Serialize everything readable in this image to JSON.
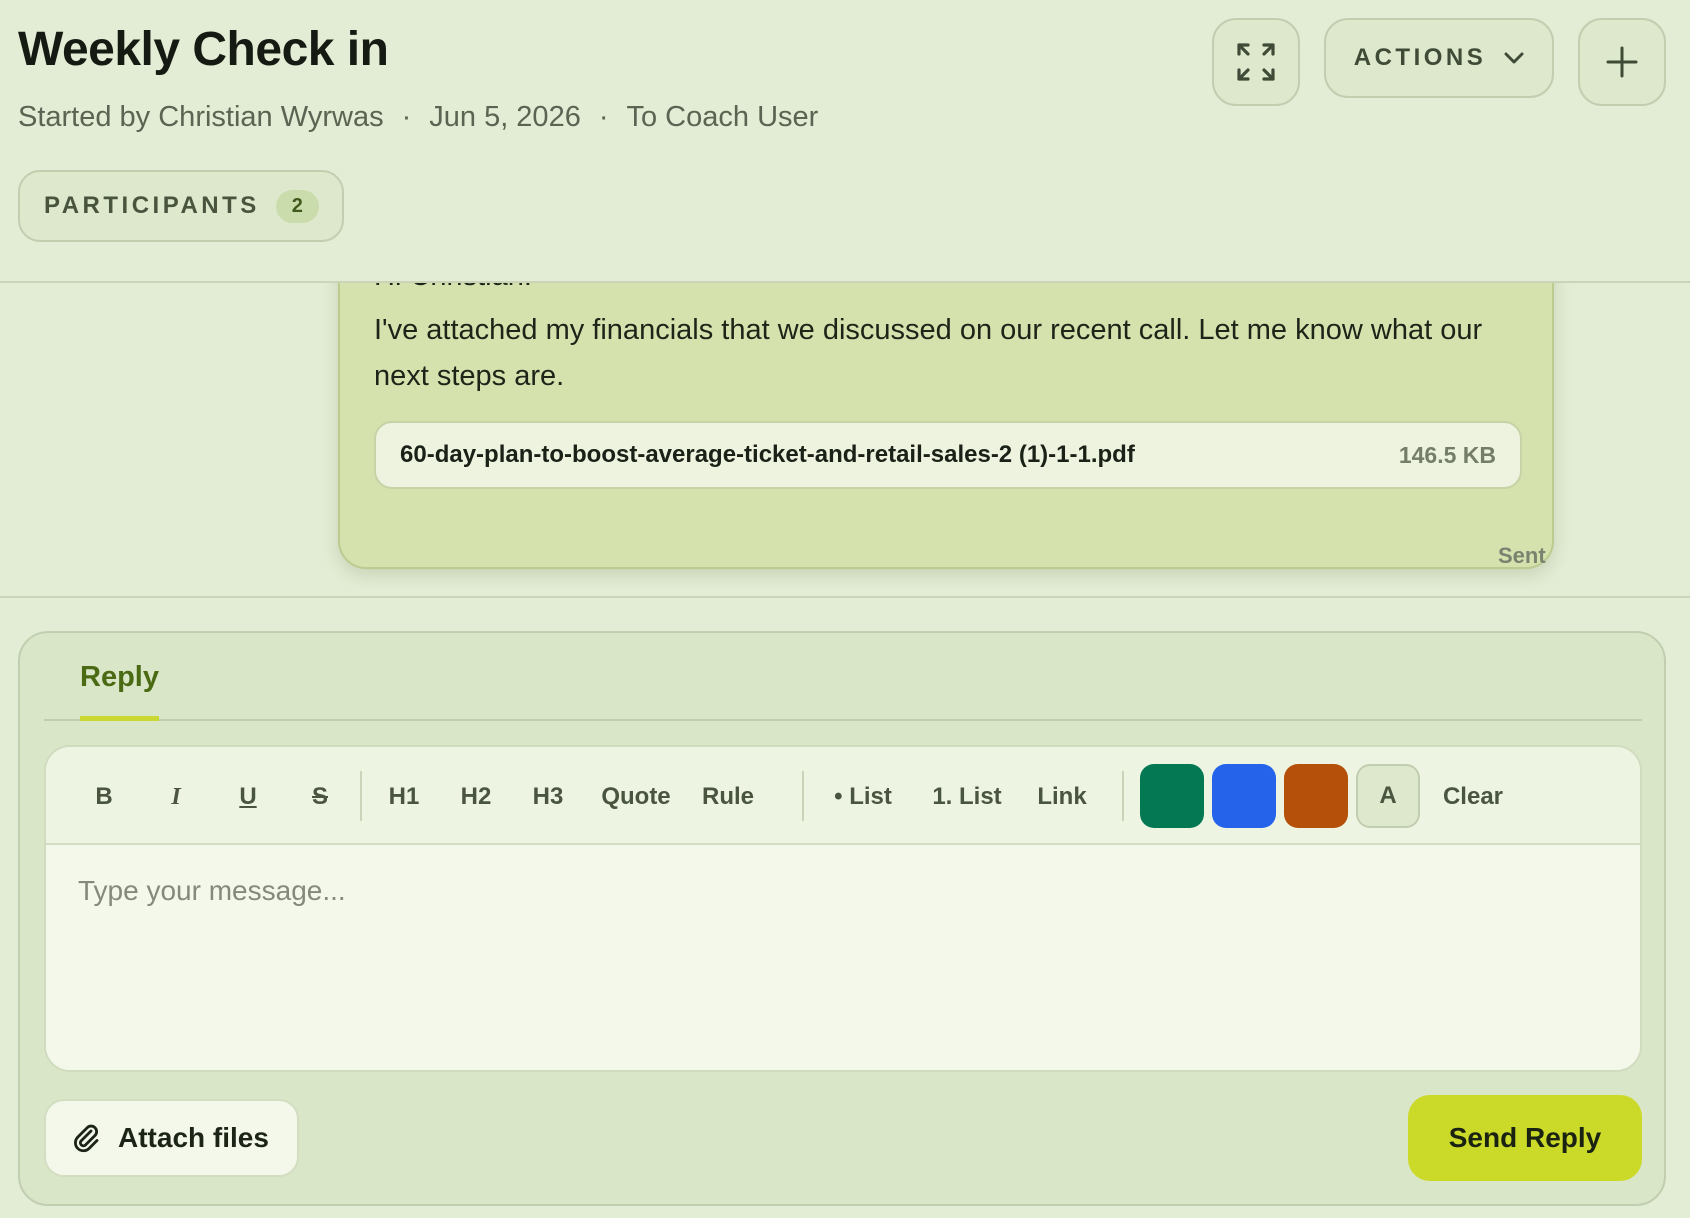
{
  "header": {
    "title": "Weekly Check in",
    "started_by": "Started by Christian Wyrwas",
    "date": "Jun 5, 2026",
    "to": "To Coach User",
    "separator": "·",
    "participants_label": "PARTICIPANTS",
    "participants_count": "2",
    "actions_label": "ACTIONS"
  },
  "message": {
    "greeting": "Hi Christian!",
    "body": "I've attached my financials that we discussed on our recent call. Let me know what our next steps are.",
    "attachment": {
      "filename": "60-day-plan-to-boost-average-ticket-and-retail-sales-2 (1)-1-1.pdf",
      "size": "146.5 KB"
    },
    "status": "Sent"
  },
  "composer": {
    "tab_label": "Reply",
    "toolbar": {
      "bold": "B",
      "italic": "I",
      "underline": "U",
      "strike": "S",
      "h1": "H1",
      "h2": "H2",
      "h3": "H3",
      "quote": "Quote",
      "rule": "Rule",
      "bullet_list": "• List",
      "numbered_list": "1. List",
      "link": "Link",
      "swatch_letter": "A",
      "clear": "Clear"
    },
    "colors": {
      "green": "#037853",
      "blue": "#2563eb",
      "orange": "#b5500a"
    },
    "placeholder": "Type your message...",
    "attach_label": "Attach files",
    "send_label": "Send Reply"
  },
  "icons": {
    "expand": "expand-icon",
    "chevron": "chevron-down-icon",
    "plus": "plus-icon",
    "paperclip": "paperclip-icon"
  }
}
